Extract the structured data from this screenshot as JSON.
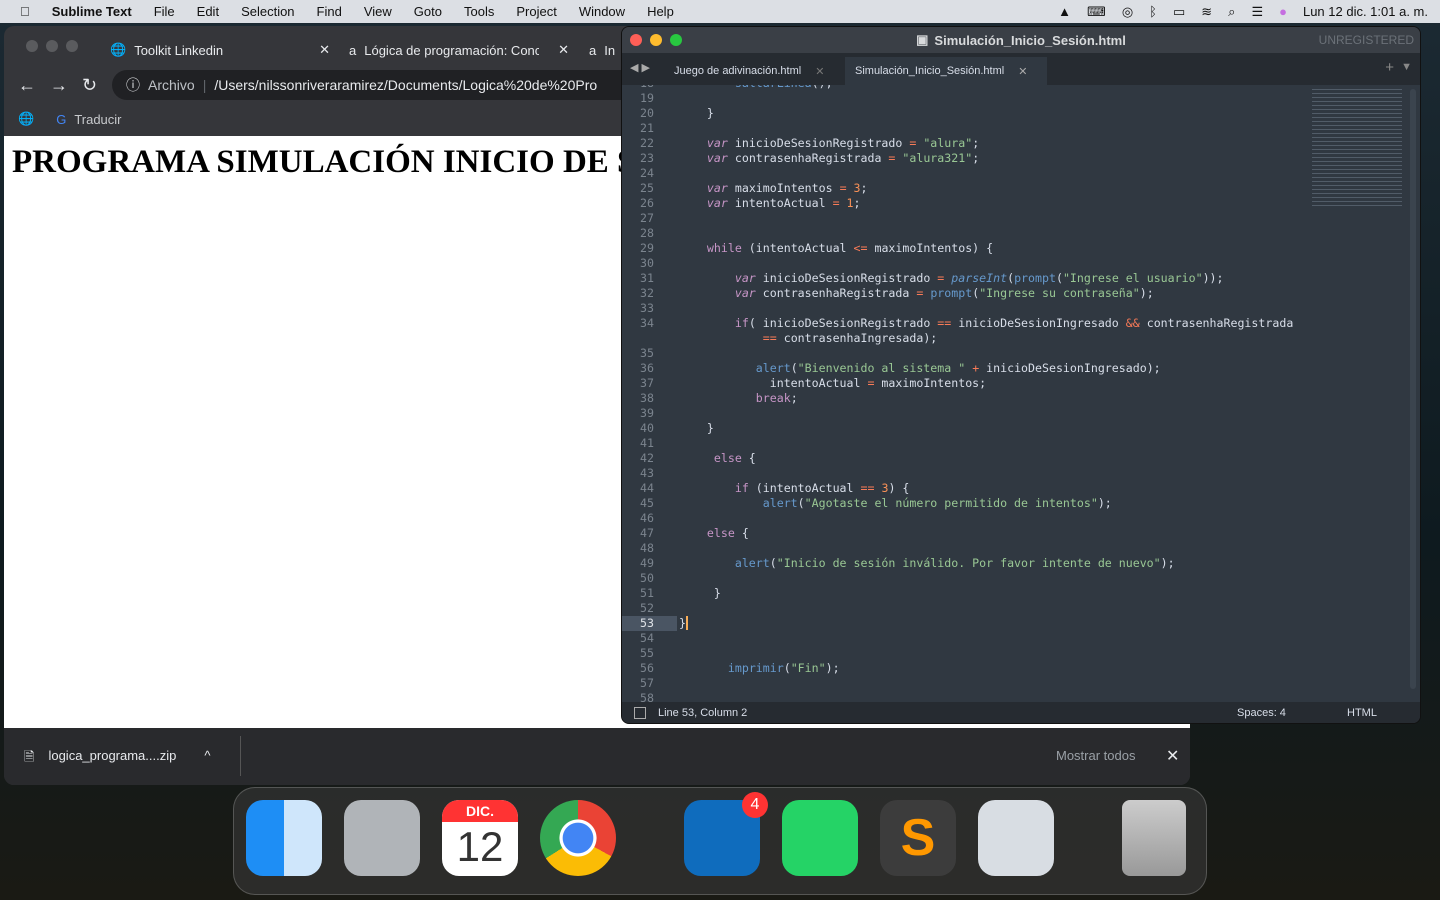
{
  "menubar": {
    "app": "Sublime Text",
    "items": [
      "File",
      "Edit",
      "Selection",
      "Find",
      "View",
      "Goto",
      "Tools",
      "Project",
      "Window",
      "Help"
    ],
    "clock": "Lun 12 dic.  1:01 a. m."
  },
  "chrome": {
    "tabs": [
      {
        "label": "Toolkit Linkedin"
      },
      {
        "label": "Lógica de programación: Conc"
      },
      {
        "label": "In"
      }
    ],
    "address_prefix": "Archivo",
    "url": "/Users/nilssonriveraramirez/Documents/Logica%20de%20Pro",
    "bookmark": "Traducir",
    "page_heading": "PROGRAMA SIMULACIÓN INICIO DE SESIÓN",
    "download": {
      "file": "logica_programa....zip",
      "show_all": "Mostrar todos"
    }
  },
  "sublime": {
    "title": "Simulación_Inicio_Sesión.html",
    "unregistered": "UNREGISTERED",
    "tabs": [
      {
        "label": "Juego de adivinación.html",
        "active": false
      },
      {
        "label": "Simulación_Inicio_Sesión.html",
        "active": true
      }
    ],
    "status": {
      "position": "Line 53, Column 2",
      "spaces": "Spaces: 4",
      "syntax": "HTML"
    },
    "current_line": 53,
    "lines": [
      {
        "n": "18",
        "seg": [
          [
            "",
            "        "
          ],
          [
            "fn",
            "saltarLinea"
          ],
          [
            "",
            "();"
          ]
        ]
      },
      {
        "n": "19",
        "seg": []
      },
      {
        "n": "20",
        "seg": [
          [
            "",
            "    }"
          ]
        ]
      },
      {
        "n": "21",
        "seg": []
      },
      {
        "n": "22",
        "seg": [
          [
            "",
            "    "
          ],
          [
            "it",
            "var"
          ],
          [
            "",
            " inicioDeSesionRegistrado "
          ],
          [
            "op",
            "="
          ],
          [
            "st",
            " \"alura\""
          ],
          [
            "",
            ";"
          ]
        ]
      },
      {
        "n": "23",
        "seg": [
          [
            "",
            "    "
          ],
          [
            "it",
            "var"
          ],
          [
            "",
            " contrasenhaRegistrada "
          ],
          [
            "op",
            "="
          ],
          [
            "st",
            " \"alura321\""
          ],
          [
            "",
            ";"
          ]
        ]
      },
      {
        "n": "24",
        "seg": []
      },
      {
        "n": "25",
        "seg": [
          [
            "",
            "    "
          ],
          [
            "it",
            "var"
          ],
          [
            "",
            " maximoIntentos "
          ],
          [
            "op",
            "="
          ],
          [
            "nu",
            " 3"
          ],
          [
            "",
            ";"
          ]
        ]
      },
      {
        "n": "26",
        "seg": [
          [
            "",
            "    "
          ],
          [
            "it",
            "var"
          ],
          [
            "",
            " intentoActual "
          ],
          [
            "op",
            "="
          ],
          [
            "nu",
            " 1"
          ],
          [
            "",
            ";"
          ]
        ]
      },
      {
        "n": "27",
        "seg": []
      },
      {
        "n": "28",
        "seg": []
      },
      {
        "n": "29",
        "seg": [
          [
            "",
            "    "
          ],
          [
            "kw",
            "while"
          ],
          [
            "",
            " (intentoActual "
          ],
          [
            "op",
            "<="
          ],
          [
            "",
            " maximoIntentos) {"
          ]
        ]
      },
      {
        "n": "30",
        "seg": []
      },
      {
        "n": "31",
        "seg": [
          [
            "",
            "        "
          ],
          [
            "it",
            "var"
          ],
          [
            "",
            " inicioDeSesionRegistrado "
          ],
          [
            "op",
            "="
          ],
          [
            "",
            " "
          ],
          [
            "fi",
            "parseInt"
          ],
          [
            "",
            "("
          ],
          [
            "fn",
            "prompt"
          ],
          [
            "",
            "("
          ],
          [
            "st",
            "\"Ingrese el usuario\""
          ],
          [
            "",
            "));"
          ]
        ]
      },
      {
        "n": "32",
        "seg": [
          [
            "",
            "        "
          ],
          [
            "it",
            "var"
          ],
          [
            "",
            " contrasenhaRegistrada "
          ],
          [
            "op",
            "="
          ],
          [
            "",
            " "
          ],
          [
            "fn",
            "prompt"
          ],
          [
            "",
            "("
          ],
          [
            "st",
            "\"Ingrese su contraseña\""
          ],
          [
            "",
            ");"
          ]
        ]
      },
      {
        "n": "33",
        "seg": []
      },
      {
        "n": "34",
        "seg": [
          [
            "",
            "        "
          ],
          [
            "kw",
            "if"
          ],
          [
            "",
            "( inicioDeSesionRegistrado "
          ],
          [
            "op",
            "=="
          ],
          [
            "",
            " inicioDeSesionIngresado "
          ],
          [
            "op",
            "&&"
          ],
          [
            "",
            " contrasenhaRegistrada"
          ]
        ]
      },
      {
        "n": "",
        "seg": [
          [
            "",
            "            "
          ],
          [
            "op",
            "=="
          ],
          [
            "",
            " contrasenhaIngresada);"
          ]
        ]
      },
      {
        "n": "35",
        "seg": []
      },
      {
        "n": "36",
        "seg": [
          [
            "",
            "           "
          ],
          [
            "fn",
            "alert"
          ],
          [
            "",
            "("
          ],
          [
            "st",
            "\"Bienvenido al sistema \""
          ],
          [
            "",
            " "
          ],
          [
            "op",
            "+"
          ],
          [
            "",
            " inicioDeSesionIngresado);"
          ]
        ]
      },
      {
        "n": "37",
        "seg": [
          [
            "",
            "             intentoActual "
          ],
          [
            "op",
            "="
          ],
          [
            "",
            " maximoIntentos;"
          ]
        ]
      },
      {
        "n": "38",
        "seg": [
          [
            "",
            "           "
          ],
          [
            "kw",
            "break"
          ],
          [
            "",
            ";"
          ]
        ]
      },
      {
        "n": "39",
        "seg": []
      },
      {
        "n": "40",
        "seg": [
          [
            "",
            "    }"
          ]
        ]
      },
      {
        "n": "41",
        "seg": []
      },
      {
        "n": "42",
        "seg": [
          [
            "",
            "     "
          ],
          [
            "kw",
            "else"
          ],
          [
            "",
            " {"
          ]
        ]
      },
      {
        "n": "43",
        "seg": []
      },
      {
        "n": "44",
        "seg": [
          [
            "",
            "        "
          ],
          [
            "kw",
            "if"
          ],
          [
            "",
            " (intentoActual "
          ],
          [
            "op",
            "=="
          ],
          [
            "nu",
            " 3"
          ],
          [
            "",
            ") {"
          ]
        ]
      },
      {
        "n": "45",
        "seg": [
          [
            "",
            "            "
          ],
          [
            "fn",
            "alert"
          ],
          [
            "",
            "("
          ],
          [
            "st",
            "\"Agotaste el número permitido de intentos\""
          ],
          [
            "",
            ");"
          ]
        ]
      },
      {
        "n": "46",
        "seg": []
      },
      {
        "n": "47",
        "seg": [
          [
            "",
            "    "
          ],
          [
            "kw",
            "else"
          ],
          [
            "",
            " {"
          ]
        ]
      },
      {
        "n": "48",
        "seg": []
      },
      {
        "n": "49",
        "seg": [
          [
            "",
            "        "
          ],
          [
            "fn",
            "alert"
          ],
          [
            "",
            "("
          ],
          [
            "st",
            "\"Inicio de sesión inválido. Por favor intente de nuevo\""
          ],
          [
            "",
            ");"
          ]
        ]
      },
      {
        "n": "50",
        "seg": []
      },
      {
        "n": "51",
        "seg": [
          [
            "",
            "     }"
          ]
        ]
      },
      {
        "n": "52",
        "seg": []
      },
      {
        "n": "53",
        "seg": [
          [
            "",
            "}"
          ]
        ]
      },
      {
        "n": "54",
        "seg": []
      },
      {
        "n": "55",
        "seg": []
      },
      {
        "n": "56",
        "seg": [
          [
            "",
            "       "
          ],
          [
            "fn",
            "imprimir"
          ],
          [
            "",
            "("
          ],
          [
            "st",
            "\"Fin\""
          ],
          [
            "",
            ");"
          ]
        ]
      },
      {
        "n": "57",
        "seg": []
      },
      {
        "n": "58",
        "seg": []
      }
    ]
  },
  "dock": {
    "calendar_month": "DIC.",
    "calendar_day": "12",
    "outlook_badge": "4",
    "apps": [
      "finder",
      "launchpad",
      "calendar",
      "chrome",
      "outlook",
      "whatsapp",
      "sublime-text",
      "preview",
      "trash"
    ]
  }
}
